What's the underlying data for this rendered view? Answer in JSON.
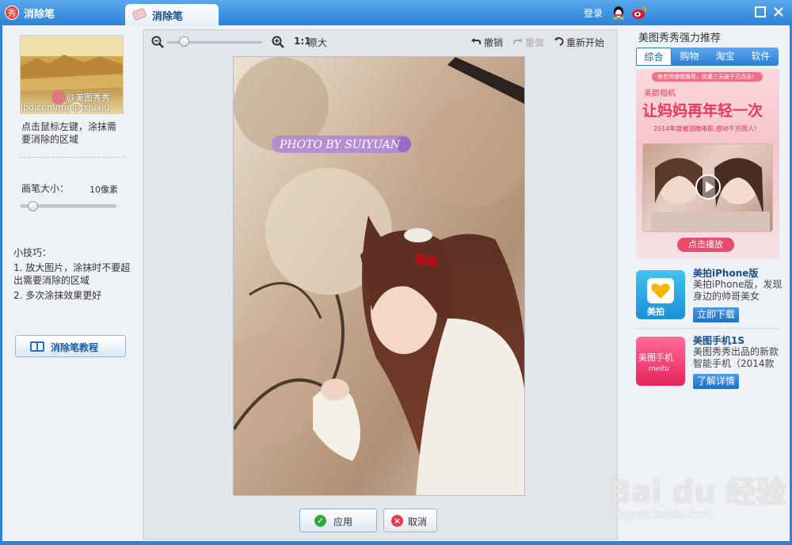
{
  "app": {
    "title": "消除笔",
    "logo_char": "秀",
    "login": "登录"
  },
  "tab": {
    "label": "消除笔"
  },
  "left": {
    "thumb_caption": "ibo.com/meituxiuxiu",
    "thumb_caption_top": "@美图秀秀",
    "hint": "点击鼠标左键，涂抹需要消除的区域",
    "brush_label": "画笔大小：",
    "brush_value": "10像素",
    "brush_level": 0.1,
    "tips_title": "小技巧：",
    "tip1": "1. 放大图片，涂抹时不要超　出需要消除的区域",
    "tip2": "2. 多次涂抹效果更好",
    "tutorial_label": "消除笔教程"
  },
  "toolbar": {
    "ratio": "1:1",
    "original": "原大",
    "undo": "撤销",
    "redo": "重做",
    "reset": "重新开始",
    "zoom_level": 0.1
  },
  "canvas": {
    "watermark_text": "PHOTO BY SUIYUAN"
  },
  "actions": {
    "apply": "应用",
    "cancel": "取消"
  },
  "right": {
    "title": "美图秀秀强力推荐",
    "tabs": [
      "综合",
      "购物",
      "淘宝",
      "软件"
    ],
    "ad": {
      "strip": "美老师爆情推荐，优惠三天破千万点击！",
      "brand": "美颜相机",
      "headline": "让妈妈再年轻一次",
      "sub": "2014年度催泪微电影,感动千万国人!",
      "play": "点击播放"
    },
    "apps": [
      {
        "name": "美拍iPhone版",
        "desc": "美拍iPhone版，发现身边的帅哥美女",
        "button": "立即下载",
        "icon_text": "美拍"
      },
      {
        "name": "美图手机1S",
        "desc": "美图秀秀出品的新款智能手机（2014款",
        "button": "了解详情",
        "icon_text": "美图手机"
      }
    ]
  },
  "watermark": {
    "main": "Bai du 经验",
    "sub": "jingyan.baidu.com"
  }
}
